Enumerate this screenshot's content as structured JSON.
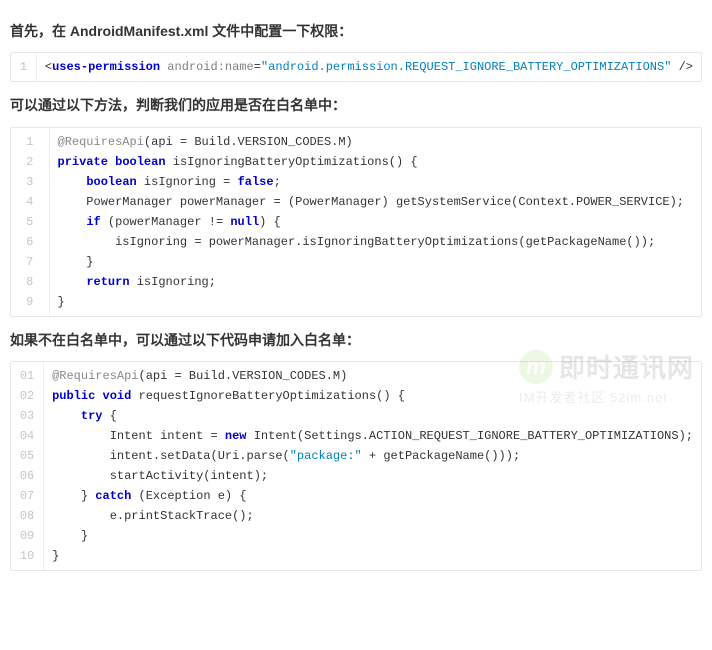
{
  "sections": [
    {
      "heading_pre": "首先，在 ",
      "heading_bold": "AndroidManifest.xml",
      "heading_post": " 文件中配置一下权限：",
      "gutter_width": 1,
      "code": [
        [
          {
            "c": "tok-punct",
            "t": "<"
          },
          {
            "c": "tok-tag",
            "t": "uses-permission"
          },
          {
            "c": "tok-plain",
            "t": " "
          },
          {
            "c": "tok-attr",
            "t": "android:name"
          },
          {
            "c": "tok-punct",
            "t": "="
          },
          {
            "c": "tok-str",
            "t": "\"android.permission.REQUEST_IGNORE_BATTERY_OPTIMIZATIONS\""
          },
          {
            "c": "tok-plain",
            "t": " "
          },
          {
            "c": "tok-punct",
            "t": "/>"
          }
        ]
      ]
    },
    {
      "heading_pre": "可以通过以下方法，判断我们的应用是否在白名单中：",
      "heading_bold": "",
      "heading_post": "",
      "gutter_width": 1,
      "code": [
        [
          {
            "c": "tok-ann",
            "t": "@RequiresApi"
          },
          {
            "c": "tok-plain",
            "t": "(api = Build.VERSION_CODES.M)"
          }
        ],
        [
          {
            "c": "tok-keyword",
            "t": "private"
          },
          {
            "c": "tok-plain",
            "t": " "
          },
          {
            "c": "tok-keyword",
            "t": "boolean"
          },
          {
            "c": "tok-plain",
            "t": " isIgnoringBatteryOptimizations() {"
          }
        ],
        [
          {
            "c": "tok-plain",
            "t": "    "
          },
          {
            "c": "tok-keyword",
            "t": "boolean"
          },
          {
            "c": "tok-plain",
            "t": " isIgnoring = "
          },
          {
            "c": "tok-keyword",
            "t": "false"
          },
          {
            "c": "tok-plain",
            "t": ";"
          }
        ],
        [
          {
            "c": "tok-plain",
            "t": "    PowerManager powerManager = (PowerManager) getSystemService(Context.POWER_SERVICE);"
          }
        ],
        [
          {
            "c": "tok-plain",
            "t": "    "
          },
          {
            "c": "tok-keyword",
            "t": "if"
          },
          {
            "c": "tok-plain",
            "t": " (powerManager != "
          },
          {
            "c": "tok-keyword",
            "t": "null"
          },
          {
            "c": "tok-plain",
            "t": ") {"
          }
        ],
        [
          {
            "c": "tok-plain",
            "t": "        isIgnoring = powerManager.isIgnoringBatteryOptimizations(getPackageName());"
          }
        ],
        [
          {
            "c": "tok-plain",
            "t": "    }"
          }
        ],
        [
          {
            "c": "tok-plain",
            "t": "    "
          },
          {
            "c": "tok-keyword",
            "t": "return"
          },
          {
            "c": "tok-plain",
            "t": " isIgnoring;"
          }
        ],
        [
          {
            "c": "tok-plain",
            "t": "}"
          }
        ]
      ]
    },
    {
      "heading_pre": "如果不在白名单中，可以通过以下代码申请加入白名单：",
      "heading_bold": "",
      "heading_post": "",
      "gutter_width": 2,
      "code": [
        [
          {
            "c": "tok-ann",
            "t": "@RequiresApi"
          },
          {
            "c": "tok-plain",
            "t": "(api = Build.VERSION_CODES.M)"
          }
        ],
        [
          {
            "c": "tok-keyword",
            "t": "public"
          },
          {
            "c": "tok-plain",
            "t": " "
          },
          {
            "c": "tok-keyword",
            "t": "void"
          },
          {
            "c": "tok-plain",
            "t": " requestIgnoreBatteryOptimizations() {"
          }
        ],
        [
          {
            "c": "tok-plain",
            "t": "    "
          },
          {
            "c": "tok-keyword",
            "t": "try"
          },
          {
            "c": "tok-plain",
            "t": " {"
          }
        ],
        [
          {
            "c": "tok-plain",
            "t": "        Intent intent = "
          },
          {
            "c": "tok-keyword",
            "t": "new"
          },
          {
            "c": "tok-plain",
            "t": " Intent(Settings.ACTION_REQUEST_IGNORE_BATTERY_OPTIMIZATIONS);"
          }
        ],
        [
          {
            "c": "tok-plain",
            "t": "        intent.setData(Uri.parse("
          },
          {
            "c": "tok-str",
            "t": "\"package:\""
          },
          {
            "c": "tok-plain",
            "t": " + getPackageName()));"
          }
        ],
        [
          {
            "c": "tok-plain",
            "t": "        startActivity(intent);"
          }
        ],
        [
          {
            "c": "tok-plain",
            "t": "    } "
          },
          {
            "c": "tok-keyword",
            "t": "catch"
          },
          {
            "c": "tok-plain",
            "t": " (Exception e) {"
          }
        ],
        [
          {
            "c": "tok-plain",
            "t": "        e.printStackTrace();"
          }
        ],
        [
          {
            "c": "tok-plain",
            "t": "    }"
          }
        ],
        [
          {
            "c": "tok-plain",
            "t": "}"
          }
        ]
      ]
    }
  ],
  "watermark": {
    "logo_letter": "m",
    "title": "即时通讯网",
    "subtitle": "IM开发者社区  52im.net"
  }
}
